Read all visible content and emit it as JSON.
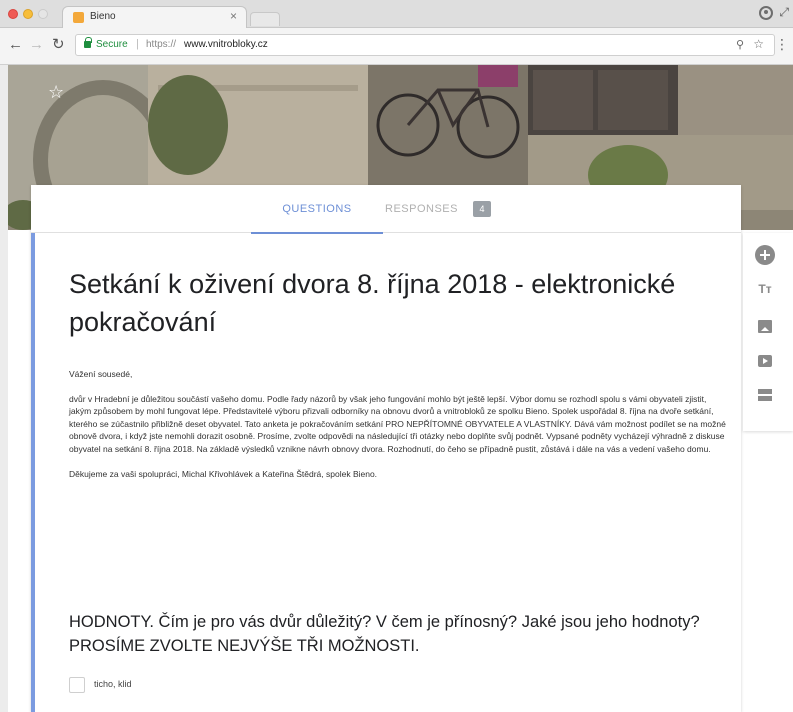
{
  "browser": {
    "tab_title": "Bieno",
    "tab_close": "×",
    "secure_label": "Secure",
    "url_scheme": "https://",
    "url_host": "www.vnitrobloky.cz"
  },
  "form": {
    "tabs": {
      "questions": "QUESTIONS",
      "responses": "RESPONSES",
      "responses_count": "4"
    },
    "title": "Setkání k oživení dvora 8. října 2018 - elektronické pokračování",
    "description": [
      "Vážení sousedé,",
      "dvůr v Hradební je důležitou součástí vašeho domu. Podle řady názorů by však jeho fungování mohlo být ještě lepší. Výbor domu se rozhodl spolu s vámi obyvateli zjistit, jakým způsobem by mohl fungovat lépe. Představitelé výboru přizvali odborníky na obnovu dvorů a vnitrobloků ze spolku Bieno. Spolek uspořádal 8. října na dvoře setkání, kterého se zúčastnilo přibližně deset obyvatel. Tato anketa je pokračováním setkání PRO NEPŘÍTOMNÉ OBYVATELE A VLASTNÍKY. Dává vám možnost podílet se na možné obnově dvora, i když jste nemohli dorazit osobně. Prosíme, zvolte odpovědi na následující tři otázky nebo doplňte svůj podnět. Vypsané podněty vycházejí výhradně z diskuse obyvatel na setkání 8. října 2018. Na základě výsledků vznikne návrh obnovy dvora. Rozhodnutí, do čeho se případně pustit, zůstává i dále na vás a vedení vašeho domu.",
      "Děkujeme za vaši spolupráci, Michal Křivohlávek a Kateřina Štědrá, spolek Bieno."
    ],
    "question": {
      "title": "HODNOTY. Čím je pro vás dvůr důležitý? V čem je přínosný? Jaké jsou jeho hodnoty? PROSÍME ZVOLTE NEJVÝŠE TŘI MOŽNOSTI.",
      "options": [
        "ticho, klid"
      ]
    }
  },
  "side_toolbar": {
    "title_glyph": "Tт"
  },
  "icons": [
    "star-icon",
    "add-question-icon",
    "add-title-icon",
    "add-image-icon",
    "add-video-icon",
    "add-section-icon",
    "lock-icon",
    "search-icon",
    "bookmark-star-icon",
    "profile-icon",
    "menu-icon"
  ],
  "colors": {
    "accent": "#6d8fd6",
    "secure": "#1e8e3e"
  }
}
